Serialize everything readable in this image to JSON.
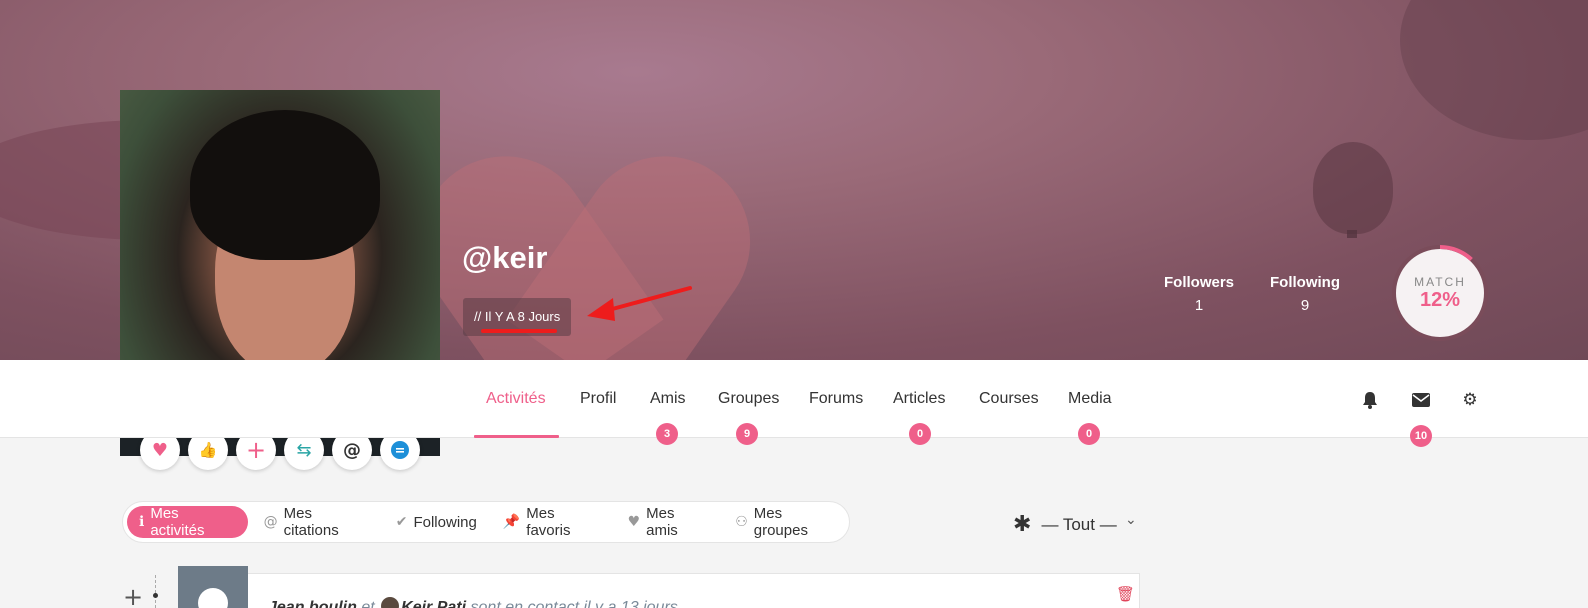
{
  "profile": {
    "username": "@keir",
    "joined": "// Il Y A 8 Jours"
  },
  "stats": {
    "followers_label": "Followers",
    "followers_value": "1",
    "following_label": "Following",
    "following_value": "9"
  },
  "match": {
    "label": "MATCH",
    "value": "12%",
    "fraction": 0.12
  },
  "quick_actions": [
    "heart-icon",
    "thumbs-up-icon",
    "plus-icon",
    "exchange-icon",
    "at-icon",
    "chat-icon"
  ],
  "tabs": [
    {
      "label": "Activités",
      "active": true
    },
    {
      "label": "Profil"
    },
    {
      "label": "Amis",
      "count": "3"
    },
    {
      "label": "Groupes",
      "count": "9"
    },
    {
      "label": "Forums"
    },
    {
      "label": "Articles",
      "count": "0"
    },
    {
      "label": "Courses"
    },
    {
      "label": "Media",
      "count": "0"
    }
  ],
  "nav_icons": {
    "messages_count": "10"
  },
  "filters": [
    {
      "label": "Mes activités",
      "icon": "info-icon",
      "active": true
    },
    {
      "label": "Mes citations",
      "icon": "at-icon"
    },
    {
      "label": "Following",
      "icon": "check-circle-icon"
    },
    {
      "label": "Mes favoris",
      "icon": "pin-icon"
    },
    {
      "label": "Mes amis",
      "icon": "heart-icon"
    },
    {
      "label": "Mes groupes",
      "icon": "group-icon"
    }
  ],
  "sort": {
    "label": "— Tout —"
  },
  "activity": {
    "actor": "Jean boulin",
    "conj": "et",
    "target": "Keir Pati",
    "action": "sont en contact",
    "time": "il y a 13 jours"
  },
  "colors": {
    "accent": "#ef5f8a",
    "danger": "#e0445a",
    "annotation": "#ee1c1c"
  }
}
